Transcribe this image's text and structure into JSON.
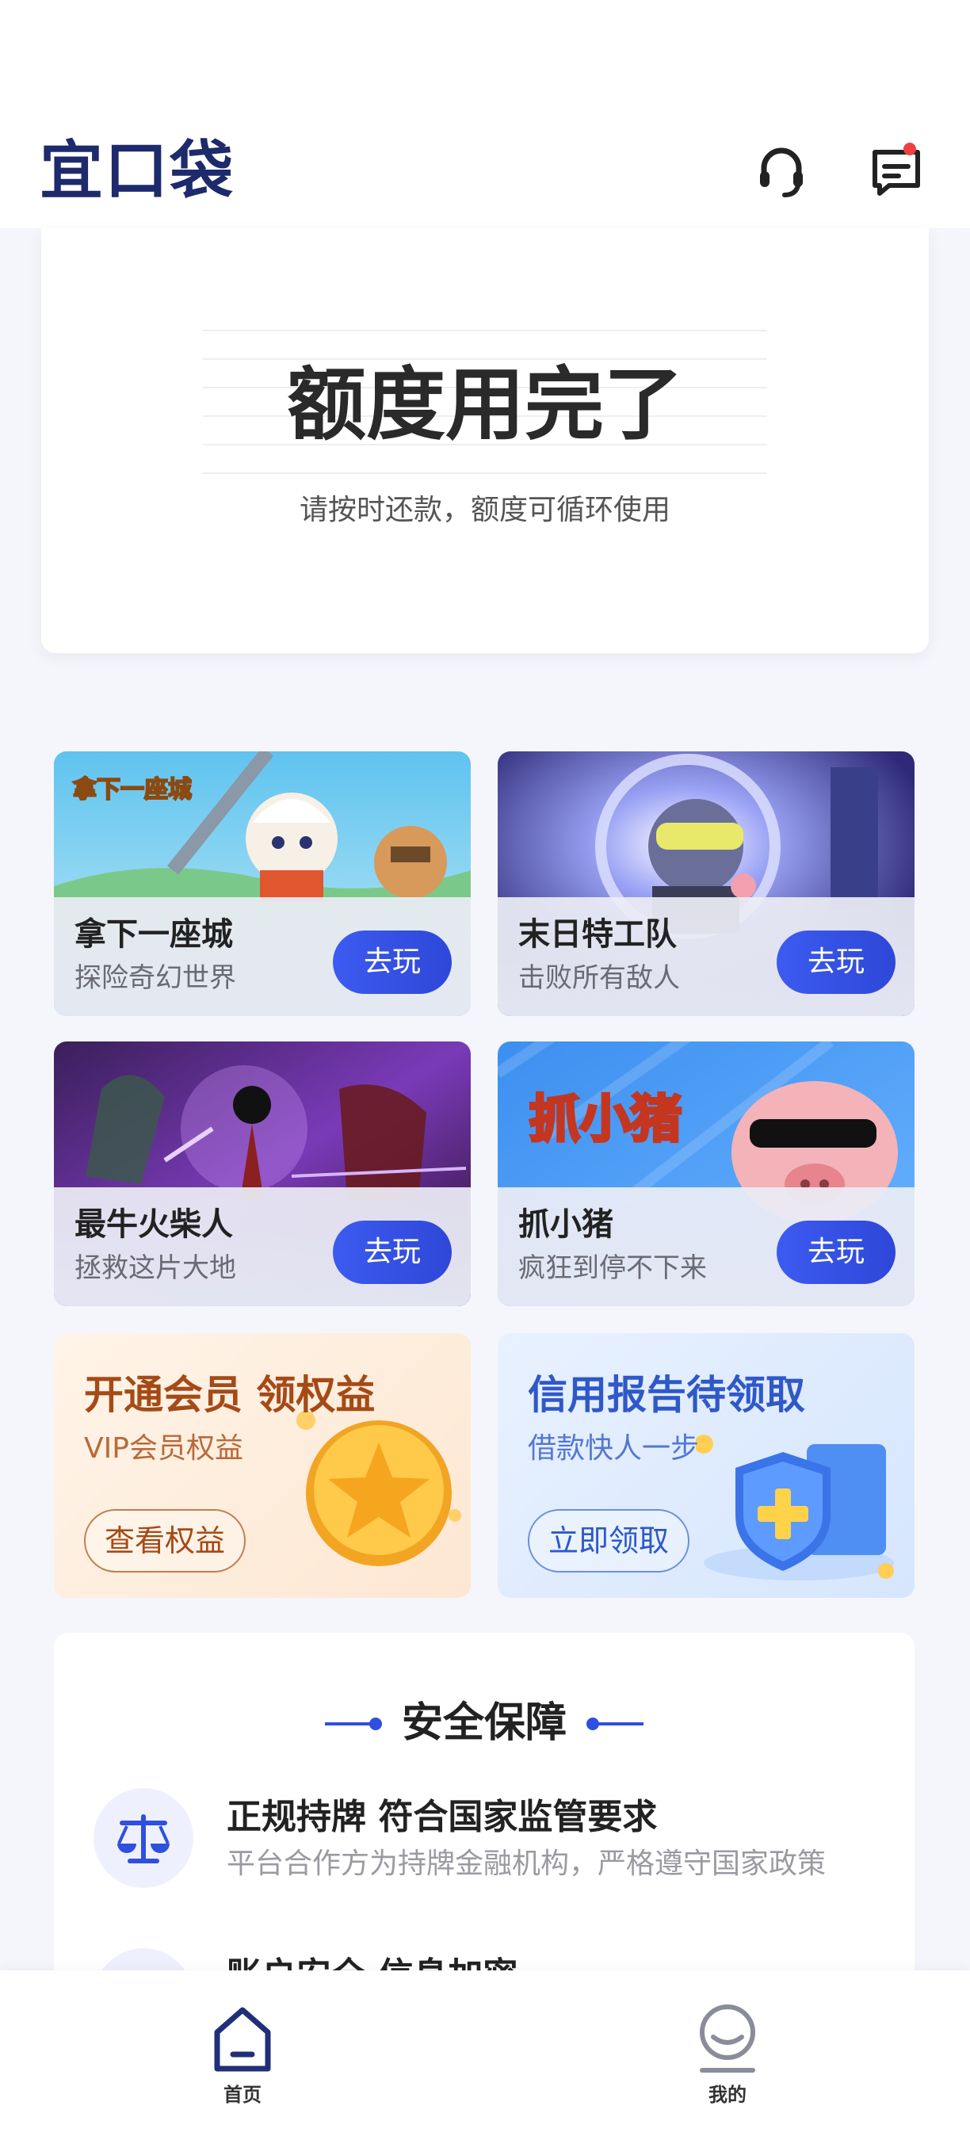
{
  "header": {
    "logo_text": "宜口袋",
    "support_icon": "headset-icon",
    "message_icon": "message-icon",
    "message_badge_color": "#f04040"
  },
  "quota": {
    "title": "额度用完了",
    "subtitle": "请按时还款，额度可循环使用"
  },
  "games": [
    {
      "name": "拿下一座城",
      "desc": "探险奇幻世界",
      "button": "去玩",
      "art_label": "拿下一座城"
    },
    {
      "name": "末日特工队",
      "desc": "击败所有敌人",
      "button": "去玩"
    },
    {
      "name": "最牛火柴人",
      "desc": "拯救这片大地",
      "button": "去玩"
    },
    {
      "name": "抓小猪",
      "desc": "疯狂到停不下来",
      "button": "去玩",
      "art_label": "抓小猪"
    }
  ],
  "promos": {
    "vip": {
      "title": "开通会员 领权益",
      "subtitle": "VIP会员权益",
      "button": "查看权益"
    },
    "credit": {
      "title": "信用报告待领取",
      "subtitle": "借款快人一步",
      "button": "立即领取"
    }
  },
  "safety": {
    "title": "安全保障",
    "items": [
      {
        "title": "正规持牌 符合国家监管要求",
        "desc": "平台合作方为持牌金融机构，严格遵守国家政策",
        "icon": "scale-icon"
      },
      {
        "title": "账户安全 信息加密",
        "desc": "",
        "icon": "lock-icon"
      }
    ]
  },
  "nav": {
    "home_label": "首页",
    "mine_label": "我的"
  },
  "colors": {
    "brand": "#1d2a6b",
    "accent": "#3c5bf0"
  }
}
